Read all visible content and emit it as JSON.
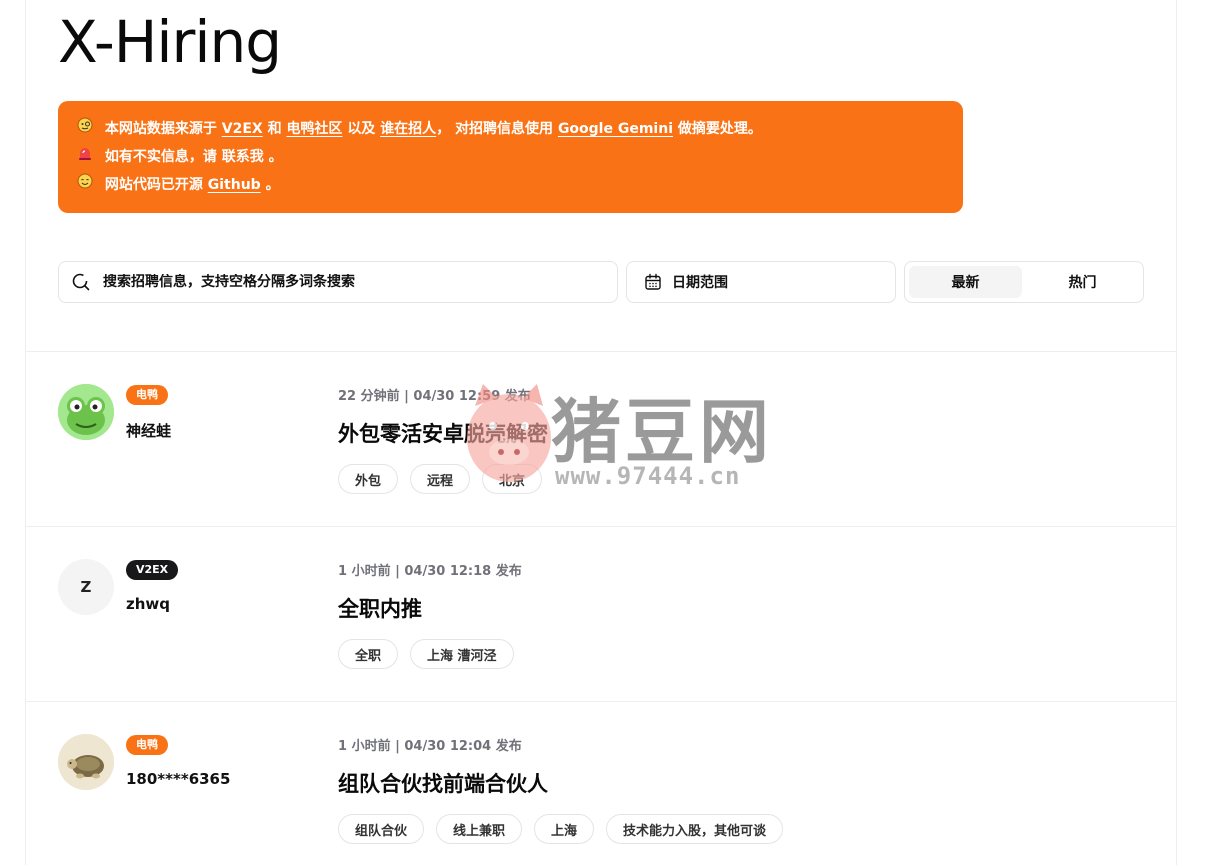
{
  "app": {
    "title": "X-Hiring"
  },
  "notice": {
    "line1": {
      "prefix": "本网站数据来源于",
      "link1": "V2EX",
      "and": "和",
      "link2": "电鸭社区",
      "also": "以及",
      "link3": "谁在招人",
      "comma": "，",
      "mid": "对招聘信息使用",
      "link4": "Google Gemini",
      "suffix": "做摘要处理。"
    },
    "line2": {
      "prefix": "如有不实信息，请",
      "link": "联系我",
      "suffix": "。"
    },
    "line3": {
      "prefix": "网站代码已开源",
      "link": "Github",
      "suffix": "。"
    },
    "icons": [
      "face-with-monocle-icon",
      "siren-icon",
      "smiling-face-icon"
    ]
  },
  "search": {
    "placeholder": "搜索招聘信息，支持空格分隔多词条搜索"
  },
  "date_filter": {
    "label": "日期范围"
  },
  "sort": {
    "tabs": [
      {
        "label": "最新",
        "active": true
      },
      {
        "label": "热门",
        "active": false
      }
    ]
  },
  "posts": [
    {
      "source": "电鸭",
      "author": "神经蛙",
      "meta": "22 分钟前 | 04/30 12:59 发布",
      "title": "外包零活安卓脱壳解密",
      "tags": [
        "外包",
        "远程",
        "北京"
      ]
    },
    {
      "source": "V2EX",
      "author": "zhwq",
      "avatar_letter": "Z",
      "meta": "1 小时前 | 04/30 12:18 发布",
      "title": "全职内推",
      "tags": [
        "全职",
        "上海 漕河泾"
      ]
    },
    {
      "source": "电鸭",
      "author": "180****6365",
      "meta": "1 小时前 | 04/30 12:04 发布",
      "title": "组队合伙找前端合伙人",
      "tags": [
        "组队合伙",
        "线上兼职",
        "上海",
        "技术能力入股，其他可谈"
      ]
    }
  ],
  "watermark": {
    "text": "猪豆网",
    "url": "www.97444.cn"
  },
  "colors": {
    "accent": "#f97316",
    "dark_badge": "#18181b"
  }
}
